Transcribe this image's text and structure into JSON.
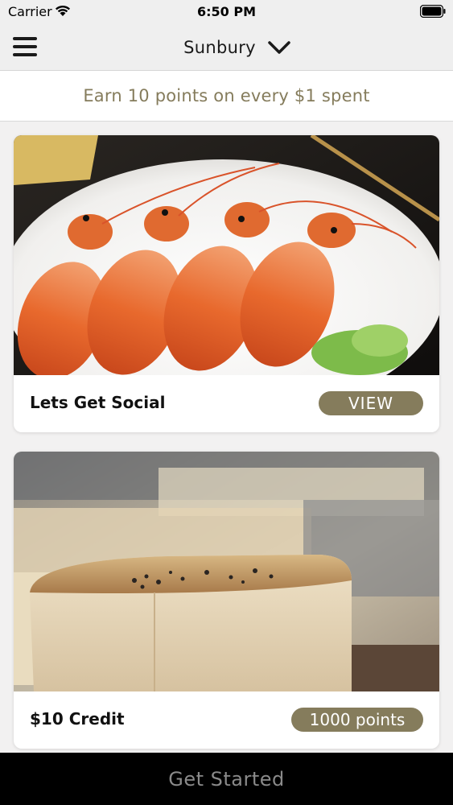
{
  "status_bar": {
    "carrier": "Carrier",
    "time": "6:50 PM"
  },
  "nav": {
    "location": "Sunbury",
    "menu_icon": "menu-icon",
    "dropdown_icon": "chevron-down-icon"
  },
  "banner": {
    "text": "Earn 10 points on every $1 spent"
  },
  "cards": [
    {
      "title": "Lets Get Social",
      "action_label": "VIEW",
      "image": "prawns-photo"
    },
    {
      "title": "$10 Credit",
      "action_label": "1000 points",
      "image": "pastry-photo"
    }
  ],
  "bottom_bar": {
    "label": "Get Started"
  },
  "colors": {
    "accent": "#857c5c",
    "bottom_bar_bg": "#000000",
    "bottom_bar_text": "#8a8a8a"
  }
}
